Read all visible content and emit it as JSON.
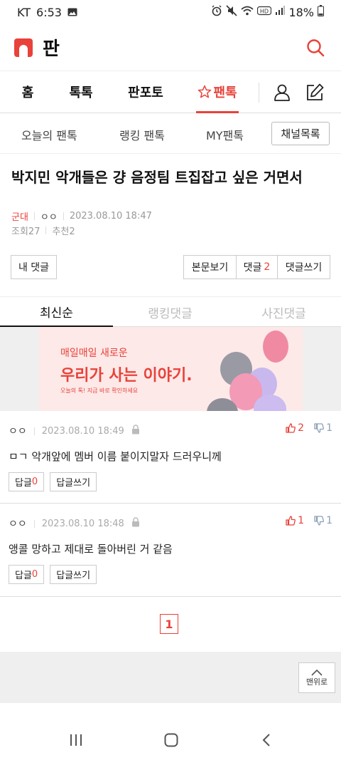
{
  "status_bar": {
    "carrier": "KT",
    "time": "6:53",
    "battery": "18%",
    "icons": [
      "gallery-icon",
      "alarm-icon",
      "mute-icon",
      "wifi-icon",
      "hd-icon",
      "signal-icon",
      "battery-icon"
    ]
  },
  "app_bar": {
    "title": "판"
  },
  "main_tabs": [
    {
      "label": "홈"
    },
    {
      "label": "톡톡"
    },
    {
      "label": "판포토"
    },
    {
      "label": "팬톡",
      "icon": "star-icon"
    }
  ],
  "sub_tabs": {
    "items": [
      {
        "label": "오늘의 팬톡"
      },
      {
        "label": "랭킹 팬톡"
      },
      {
        "label": "MY팬톡"
      }
    ],
    "channel_button": "채널목록"
  },
  "post": {
    "title": "박지민 악개들은 걍 음정팀 트집잡고 싶은 거면서",
    "category": "군대",
    "author": "ㅇㅇ",
    "date": "2023.08.10 18:47",
    "views": "조회27",
    "recommends": "추천2"
  },
  "actions": {
    "my_comment": "내 댓글",
    "view_post": "본문보기",
    "comments_label": "댓글",
    "comments_count": "2",
    "write_comment": "댓글쓰기"
  },
  "comment_tabs": [
    {
      "label": "최신순",
      "active": true
    },
    {
      "label": "랭킹댓글"
    },
    {
      "label": "사진댓글"
    }
  ],
  "banner": {
    "small": "매일매일 새로운",
    "big": "우리가 사는 이야기.",
    "tiny": "오늘의 톡! 지금 바로 확인하세요"
  },
  "comments": [
    {
      "author": "ㅇㅇ",
      "date": "2023.08.10 18:49",
      "text": "ㅁㄱ 악개앞에 멤버 이름 붙이지말자 드러우니께",
      "up": "2",
      "down": "1",
      "reply_label": "답글",
      "reply_count": "0",
      "write_reply": "답글쓰기"
    },
    {
      "author": "ㅇㅇ",
      "date": "2023.08.10 18:48",
      "text": "앵콜 망하고 제대로 돌아버린 거 같음",
      "up": "1",
      "down": "1",
      "reply_label": "답글",
      "reply_count": "0",
      "write_reply": "답글쓰기"
    }
  ],
  "pagination": {
    "current": "1"
  },
  "to_top": "맨위로",
  "colors": {
    "accent": "#e8423a",
    "downvote": "#8aa0b8"
  }
}
